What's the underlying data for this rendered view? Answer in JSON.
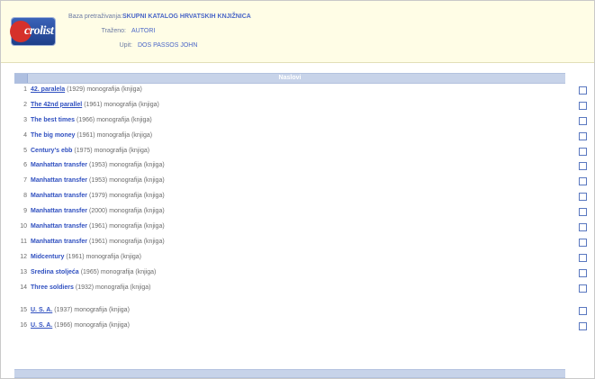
{
  "header": {
    "logo_text": "crolist",
    "fields": [
      {
        "label": "Baza pretraživanja:",
        "value": "SKUPNI KATALOG HRVATSKIH KNJIŽNICA"
      },
      {
        "label": "Traženo:",
        "value": "AUTORI"
      },
      {
        "label": "Upit:",
        "value": "DOS PASSOS JOHN"
      }
    ]
  },
  "table": {
    "title": "Naslovi",
    "rows": [
      {
        "num": "1",
        "title": "42. paralela",
        "meta": "(1929) monografija (knjiga)"
      },
      {
        "num": "2",
        "title": "The 42nd parallel",
        "meta": "(1961) monografija (knjiga)"
      },
      {
        "num": "3",
        "title": "The best times",
        "meta": "(1966) monografija (knjiga)"
      },
      {
        "num": "4",
        "title": "The big money",
        "meta": "(1961) monografija (knjiga)"
      },
      {
        "num": "5",
        "title": "Century's ebb",
        "meta": "(1975) monografija (knjiga)"
      },
      {
        "num": "6",
        "title": "Manhattan transfer",
        "meta": "(1953) monografija (knjiga)"
      },
      {
        "num": "7",
        "title": "Manhattan transfer",
        "meta": "(1953) monografija (knjiga)"
      },
      {
        "num": "8",
        "title": "Manhattan transfer",
        "meta": "(1979) monografija (knjiga)"
      },
      {
        "num": "9",
        "title": "Manhattan transfer",
        "meta": "(2000) monografija (knjiga)"
      },
      {
        "num": "10",
        "title": "Manhattan transfer",
        "meta": "(1961) monografija (knjiga)"
      },
      {
        "num": "11",
        "title": "Manhattan transfer",
        "meta": "(1961) monografija (knjiga)"
      },
      {
        "num": "12",
        "title": "Midcentury",
        "meta": "(1961) monografija (knjiga)"
      },
      {
        "num": "13",
        "title": "Sredina stoljeća",
        "meta": "(1965) monografija (knjiga)"
      },
      {
        "num": "14",
        "title": "Three soldiers",
        "meta": "(1932) monografija (knjiga)"
      },
      {
        "num": "15",
        "title": "U. S. A.",
        "meta": "(1937) monografija (knjiga)"
      },
      {
        "num": "16",
        "title": "U. S. A.",
        "meta": "(1966) monografija (knjiga)"
      }
    ]
  }
}
